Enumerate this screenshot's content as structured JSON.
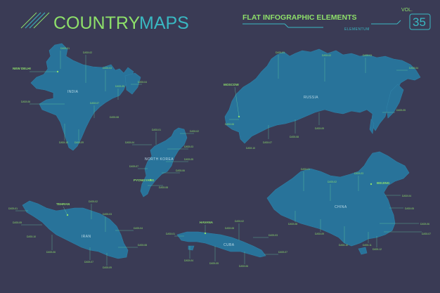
{
  "header": {
    "title_primary": "COUNTRY",
    "title_secondary": "MAPS",
    "subtitle": "FLAT INFOGRAPHIC ELEMENTS",
    "brand": "ELEMENTUM",
    "vol_label": "VOL.",
    "vol_number": "35"
  },
  "colors": {
    "background": "#3a3b55",
    "country_fill": "#28739a",
    "accent_green": "#8ee06a",
    "accent_cyan": "#39b8c2"
  },
  "countries": {
    "india": {
      "name": "INDIA",
      "capital": "NEW DELHI",
      "labels": [
        "DATA 01",
        "DATA 02",
        "DATA 03",
        "DATA 04",
        "DATA 05",
        "DATA 06",
        "DATA 07",
        "DATA 08",
        "DATA 09",
        "DATA 10"
      ]
    },
    "russia": {
      "name": "RUSSIA",
      "capital": "MOSCOW",
      "labels": [
        "DATA 01",
        "DATA 02",
        "DATA 03",
        "DATA 04",
        "DATA 05",
        "DATA 06",
        "DATA 07",
        "DATA 08",
        "DATA 09",
        "DATA 10"
      ]
    },
    "north_korea": {
      "name": "NORTH KOREA",
      "capital": "PYONGYANG",
      "labels": [
        "DATA 01",
        "DATA 02",
        "DATA 03",
        "DATA 04",
        "DATA 05",
        "DATA 06",
        "DATA 07",
        "DATA 08"
      ]
    },
    "china": {
      "name": "CHINA",
      "capital": "BEIJING",
      "labels": [
        "DATA 01",
        "DATA 02",
        "DATA 03",
        "DATA 04",
        "DATA 05",
        "DATA 06",
        "DATA 07",
        "DATA 08",
        "DATA 09",
        "DATA 10",
        "DATA 11",
        "DATA 12"
      ]
    },
    "iran": {
      "name": "IRAN",
      "capital": "TEHRAN",
      "labels": [
        "DATA 01",
        "DATA 02",
        "DATA 03",
        "DATA 04",
        "DATA 05",
        "DATA 06",
        "DATA 07",
        "DATA 08",
        "DATA 09",
        "DATA 10"
      ]
    },
    "cuba": {
      "name": "CUBA",
      "capital": "HAVANA",
      "labels": [
        "DATA 01",
        "DATA 02",
        "DATA 03",
        "DATA 04",
        "DATA 05",
        "DATA 06",
        "DATA 07",
        "DATA 08"
      ]
    }
  }
}
